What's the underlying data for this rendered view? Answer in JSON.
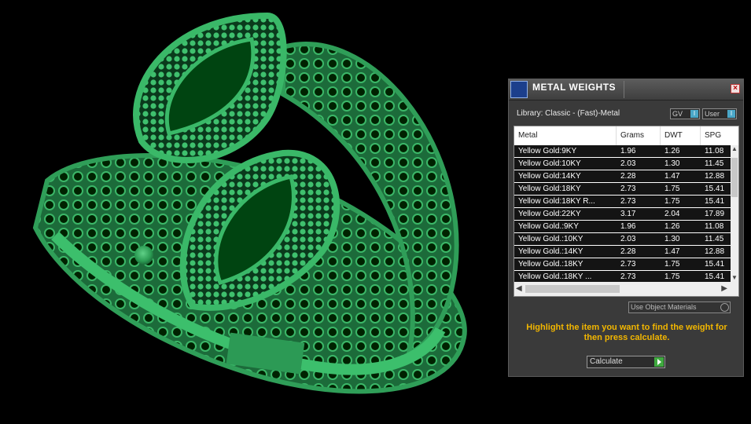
{
  "panel": {
    "title": "METAL WEIGHTS",
    "close_glyph": "×",
    "library_label": "Library: Classic - (Fast)-Metal",
    "toggle_gv": "GV",
    "toggle_user": "User",
    "toggle_knob": "I",
    "table": {
      "headers": [
        "Metal",
        "Grams",
        "DWT",
        "SPG"
      ],
      "rows": [
        [
          "Yellow Gold:9KY",
          "1.96",
          "1.26",
          "11.08"
        ],
        [
          "Yellow Gold:10KY",
          "2.03",
          "1.30",
          "11.45"
        ],
        [
          "Yellow Gold:14KY",
          "2.28",
          "1.47",
          "12.88"
        ],
        [
          "Yellow Gold:18KY",
          "2.73",
          "1.75",
          "15.41"
        ],
        [
          "Yellow Gold:18KY R...",
          "2.73",
          "1.75",
          "15.41"
        ],
        [
          "Yellow Gold:22KY",
          "3.17",
          "2.04",
          "17.89"
        ],
        [
          "Yellow Gold.:9KY",
          "1.96",
          "1.26",
          "11.08"
        ],
        [
          "Yellow Gold.:10KY",
          "2.03",
          "1.30",
          "11.45"
        ],
        [
          "Yellow Gold.:14KY",
          "2.28",
          "1.47",
          "12.88"
        ],
        [
          "Yellow Gold.:18KY",
          "2.73",
          "1.75",
          "15.41"
        ],
        [
          "Yellow Gold.:18KY ...",
          "2.73",
          "1.75",
          "15.41"
        ]
      ]
    },
    "use_object_materials": "Use Object Materials",
    "hint": "Highlight the item you want to find the weight for then press calculate.",
    "calculate_label": "Calculate"
  },
  "colors": {
    "ring_green": "#2e9a55",
    "hint_yellow": "#f2b600",
    "panel_bg": "#3a3a3a"
  }
}
